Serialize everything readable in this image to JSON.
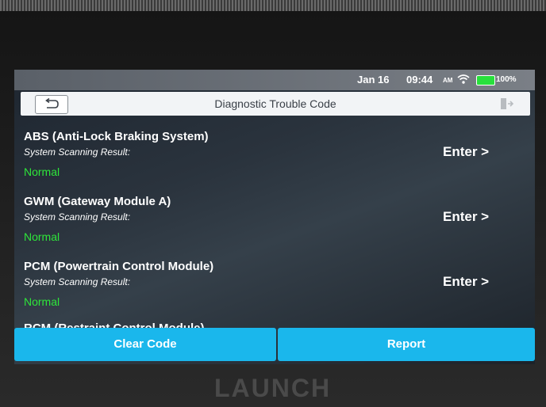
{
  "status_bar": {
    "date": "Jan 16",
    "time": "09:44",
    "ampm": "AM",
    "battery": "100%"
  },
  "title_bar": {
    "title": "Diagnostic Trouble Code"
  },
  "modules": [
    {
      "name": "ABS (Anti-Lock Braking System)",
      "result_label": "System Scanning Result:",
      "result": "Normal",
      "action": "Enter >"
    },
    {
      "name": "GWM (Gateway Module A)",
      "result_label": "System Scanning Result:",
      "result": "Normal",
      "action": "Enter >"
    },
    {
      "name": "PCM (Powertrain Control Module)",
      "result_label": "System Scanning Result:",
      "result": "Normal",
      "action": "Enter >"
    },
    {
      "name": "RCM (Restraint Control Module)"
    }
  ],
  "buttons": {
    "clear_code": "Clear Code",
    "report": "Report"
  },
  "brand": "LAUNCH",
  "colors": {
    "accent": "#1ab7ec",
    "status_ok": "#2ee63a"
  },
  "icons": {
    "back": "back-arrow-icon",
    "exit": "exit-icon",
    "wifi": "wifi-icon",
    "battery": "battery-icon"
  }
}
